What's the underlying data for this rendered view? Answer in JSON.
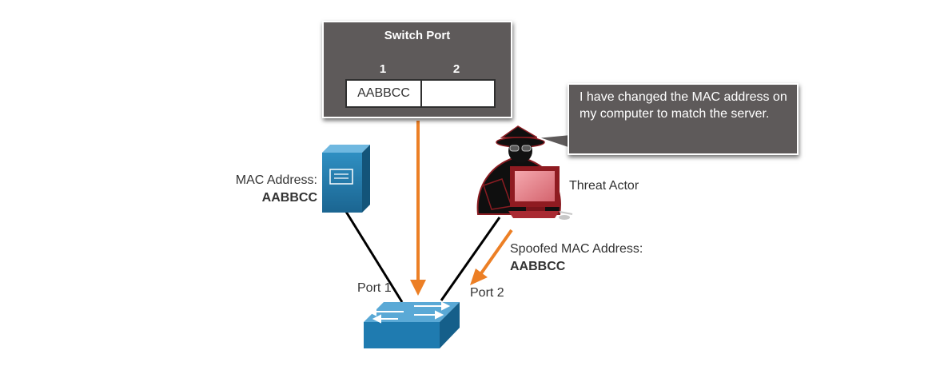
{
  "switch_table": {
    "title": "Switch Port",
    "port_headers": [
      "1",
      "2"
    ],
    "port_values": [
      "AABBCC",
      ""
    ]
  },
  "server": {
    "mac_label": "MAC Address:",
    "mac_value": "AABBCC"
  },
  "threat_actor": {
    "label": "Threat Actor",
    "speech": "I have changed the MAC address on my computer to match the server.",
    "spoofed_label": "Spoofed MAC Address:",
    "spoofed_value": "AABBCC"
  },
  "switch": {
    "port1_label": "Port 1",
    "port2_label": "Port 2"
  },
  "colors": {
    "arrow": "#ec7f25",
    "panel": "#5e5a5a",
    "device_blue": "#1f6f9c",
    "threat_red": "#9b1b22",
    "link": "#000000"
  }
}
